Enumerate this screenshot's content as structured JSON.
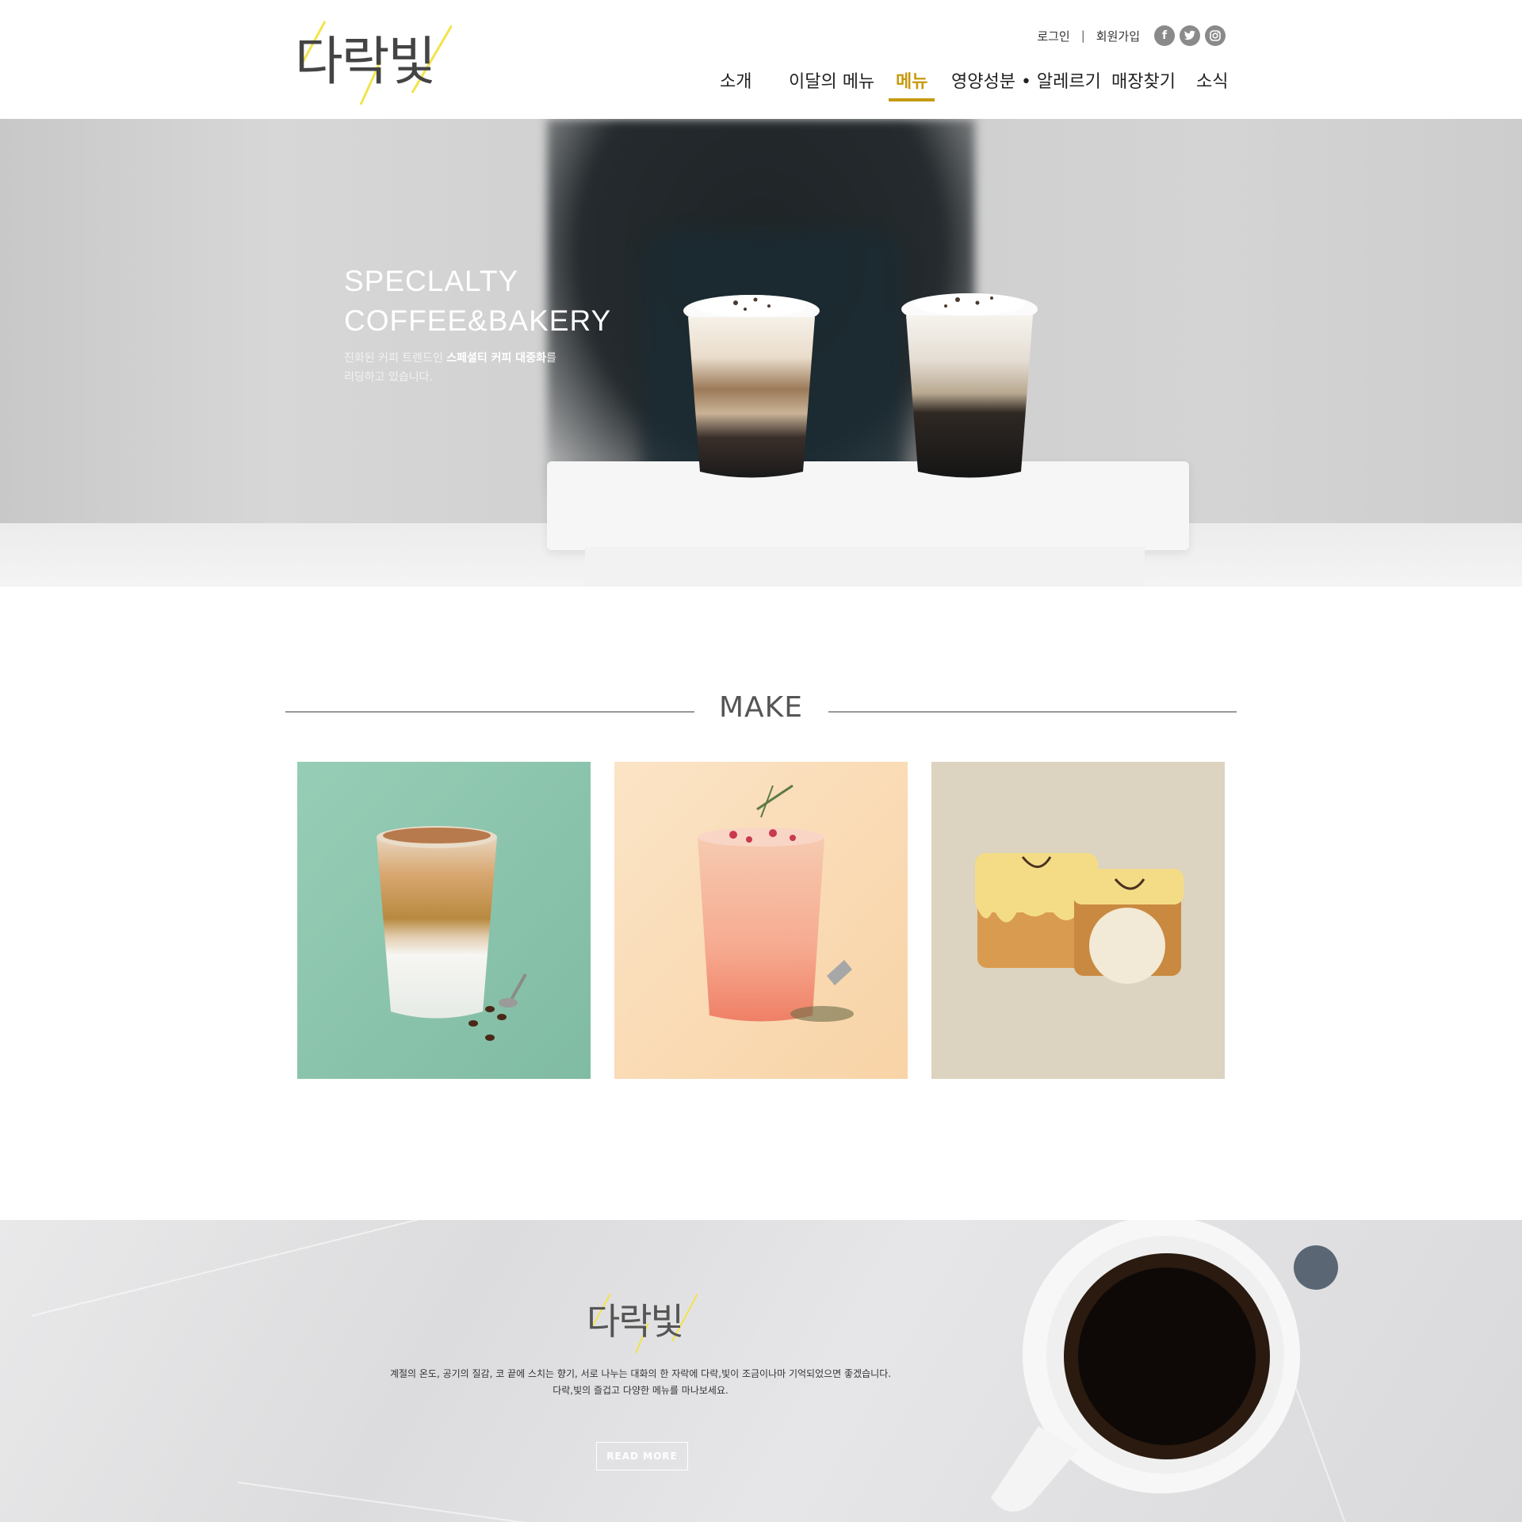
{
  "header": {
    "logo_text": "다락빛",
    "util": {
      "login": "로그인",
      "separator": "|",
      "signup": "회원가입"
    },
    "sns": [
      {
        "icon": "facebook-icon",
        "glyph": "f"
      },
      {
        "icon": "twitter-icon",
        "glyph": "t"
      },
      {
        "icon": "instagram-icon",
        "glyph": "◎"
      }
    ],
    "nav": [
      {
        "label": "소개",
        "active": false
      },
      {
        "label": "이달의 메뉴",
        "active": false
      },
      {
        "label": "메뉴",
        "active": true
      },
      {
        "label": "영양성분 • 알레르기",
        "active": false
      },
      {
        "label": "매장찾기",
        "active": false
      },
      {
        "label": "소식",
        "active": false
      }
    ],
    "accent_color": "#c79a0d"
  },
  "hero": {
    "title_line1": "SPECLALTY",
    "title_line2": "COFFEE&BAKERY",
    "desc_part1": "진화된 커피 트렌드인 ",
    "desc_bold": "스페셜티 커피 대중화",
    "desc_part2": "를",
    "desc_line2": "리딩하고 있습니다."
  },
  "make": {
    "title": "MAKE",
    "cards": [
      {
        "name": "latte-card",
        "bg": "#8fc7b0"
      },
      {
        "name": "fruit-tea-card",
        "bg": "#f9dcb6"
      },
      {
        "name": "banana-bread-card",
        "bg": "#ddd4c1"
      }
    ]
  },
  "footer": {
    "logo_text": "다락빛",
    "text_line1": "계절의 온도, 공기의 질감, 코 끝에 스치는 향기, 서로 나누는 대화의 한 자락에 다락,빛이 조금이나마 기억되었으면 좋겠습니다.",
    "text_line2": "다락,빛의 즐겁고 다양한 메뉴를 마나보세요.",
    "button_label": "READ MORE"
  }
}
